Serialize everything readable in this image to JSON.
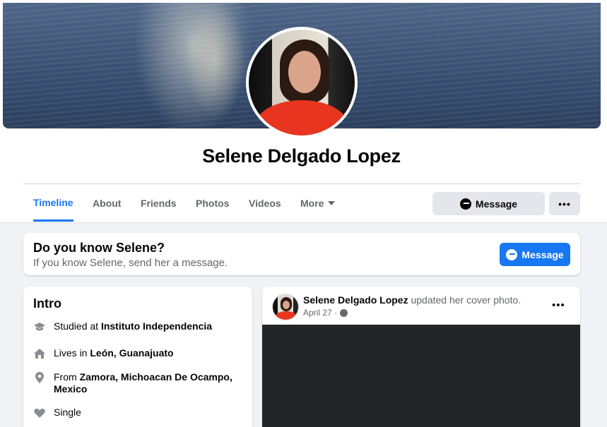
{
  "profile": {
    "name": "Selene Delgado Lopez"
  },
  "tabs": [
    {
      "label": "Timeline",
      "active": true
    },
    {
      "label": "About"
    },
    {
      "label": "Friends"
    },
    {
      "label": "Photos"
    },
    {
      "label": "Videos"
    },
    {
      "label": "More"
    }
  ],
  "actions": {
    "message_label": "Message",
    "more_label": "•••"
  },
  "know_card": {
    "title": "Do you know Selene?",
    "subtitle": "If you know Selene, send her a message.",
    "button_label": "Message"
  },
  "intro": {
    "title": "Intro",
    "items": [
      {
        "icon": "graduation-cap-icon",
        "prefix": "Studied at ",
        "value": "Instituto Independencia"
      },
      {
        "icon": "home-icon",
        "prefix": "Lives in ",
        "value": "León, Guanajuato"
      },
      {
        "icon": "location-pin-icon",
        "prefix": "From ",
        "value": "Zamora, Michoacan De Ocampo, Mexico"
      },
      {
        "icon": "heart-icon",
        "prefix": "",
        "value": "Single"
      }
    ]
  },
  "post": {
    "author": "Selene Delgado Lopez",
    "action": " updated her cover photo.",
    "date": "April 27 · ",
    "menu_label": "•••"
  },
  "colors": {
    "accent": "#1877f2",
    "background": "#f0f2f5",
    "secondary_text": "#65676b"
  }
}
